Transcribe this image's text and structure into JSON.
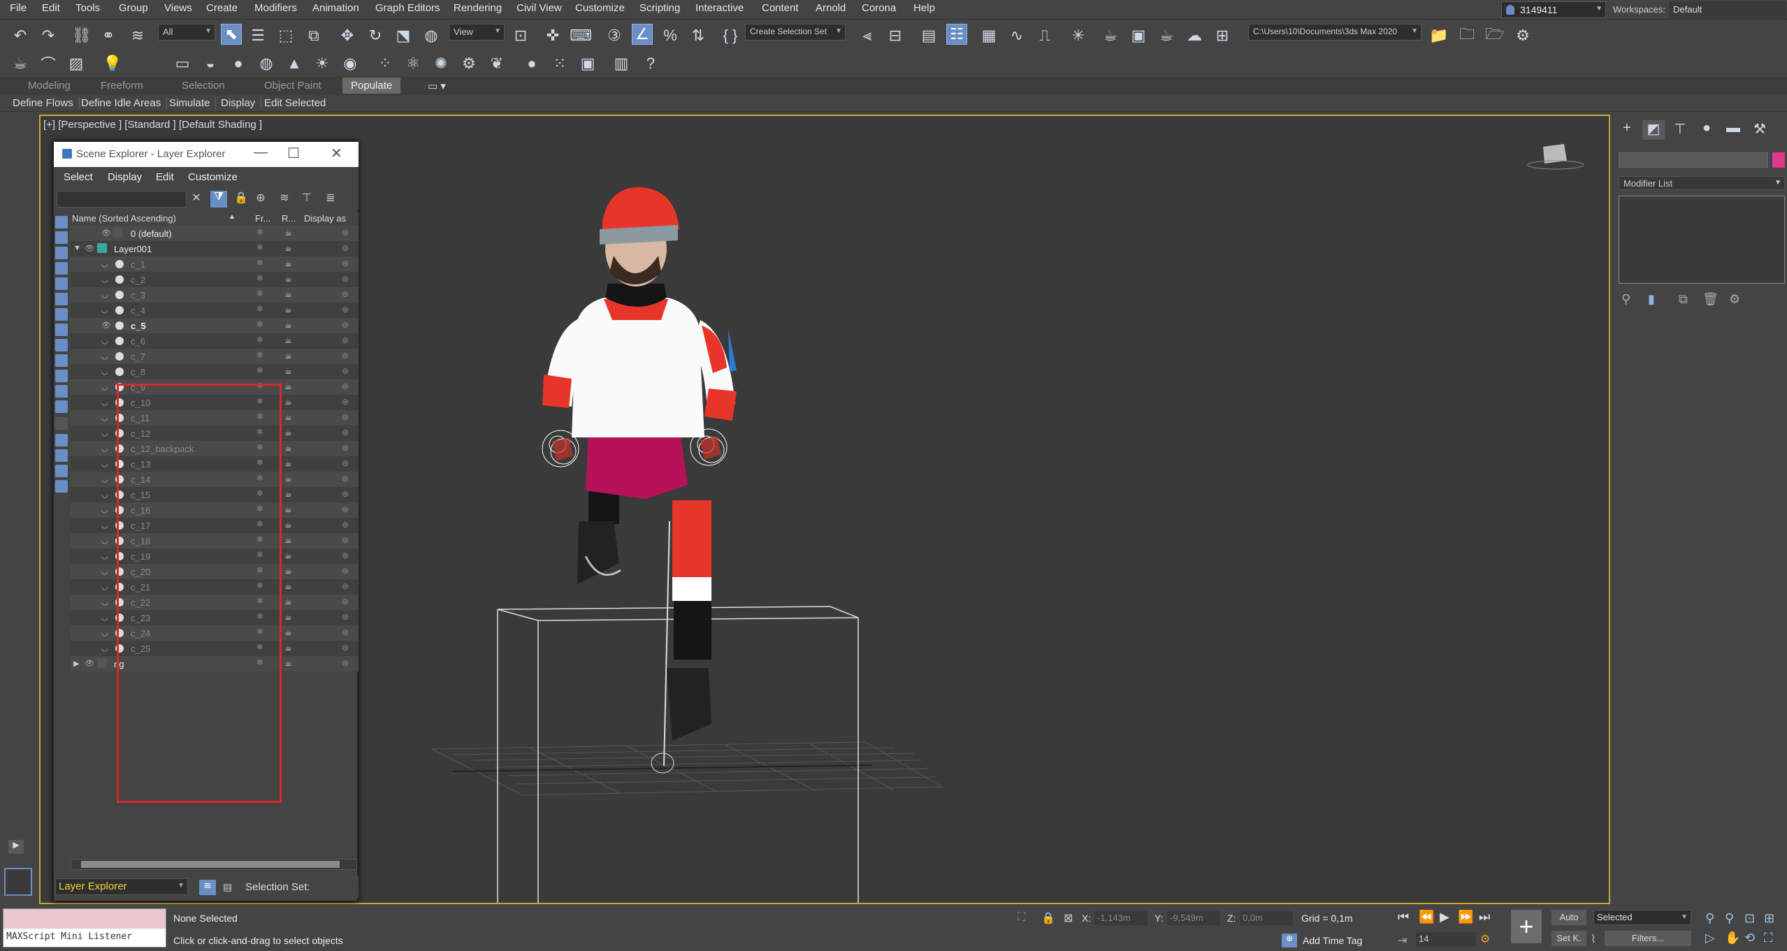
{
  "menu": [
    "File",
    "Edit",
    "Tools",
    "Group",
    "Views",
    "Create",
    "Modifiers",
    "Animation",
    "Graph Editors",
    "Rendering",
    "Civil View",
    "Customize",
    "Scripting",
    "Interactive",
    "Content",
    "Arnold",
    "Corona",
    "Help"
  ],
  "user": "3149411",
  "workspaces_label": "Workspaces:",
  "workspace": "Default",
  "toolbar": {
    "filter": "All",
    "ref_coord": "View",
    "selection_set": "Create Selection Set",
    "project_path": "C:\\Users\\10\\Documents\\3ds Max 2020"
  },
  "ribbon_tabs": [
    "Modeling",
    "Freeform",
    "Selection",
    "Object Paint",
    "Populate"
  ],
  "ribbon_sub": [
    "Define Flows",
    "Define Idle Areas",
    "Simulate",
    "Display",
    "Edit Selected"
  ],
  "viewport_label": "[+] [Perspective ] [Standard ] [Default Shading ]",
  "explorer": {
    "title": "Scene Explorer - Layer Explorer",
    "menu": [
      "Select",
      "Display",
      "Edit",
      "Customize"
    ],
    "columns": {
      "name": "Name (Sorted Ascending)",
      "fr": "Fr...",
      "r": "R...",
      "box": "Display as Box"
    },
    "rows": [
      "0 (default)",
      "Layer001",
      "c_1",
      "c_2",
      "c_3",
      "c_4",
      "c_5",
      "c_6",
      "c_7",
      "c_8",
      "c_9",
      "c_10",
      "c_11",
      "c_12",
      "c_12_backpack",
      "c_13",
      "c_14",
      "c_15",
      "c_16",
      "c_17",
      "c_18",
      "c_19",
      "c_20",
      "c_21",
      "c_22",
      "c_23",
      "c_24",
      "c_25",
      "rig"
    ],
    "mode": "Layer Explorer",
    "selection_set_label": "Selection Set:"
  },
  "right_panel": {
    "modifier_list": "Modifier List",
    "object_color": "#e0398a"
  },
  "status": {
    "listener": "MAXScript Mini Listener",
    "selection": "None Selected",
    "prompt": "Click or click-and-drag to select objects",
    "x_label": "X:",
    "x": "-1,143m",
    "y_label": "Y:",
    "y": "-9,549m",
    "z_label": "Z:",
    "z": "0,0m",
    "grid": "Grid = 0,1m",
    "add_time_tag": "Add Time Tag",
    "frame": "14",
    "auto": "Auto",
    "set_key": "Set K.",
    "key_filter": "Selected",
    "filters": "Filters..."
  }
}
